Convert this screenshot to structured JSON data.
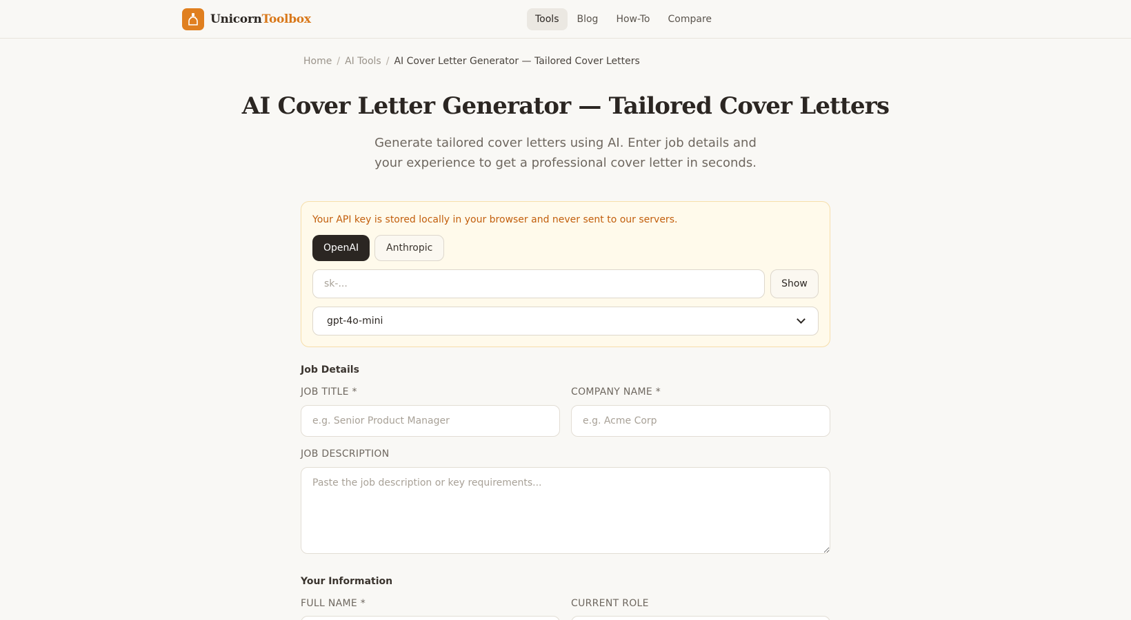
{
  "brand": {
    "name_part1": "Unicorn",
    "name_part2": "Toolbox",
    "accent_color": "#e07f1f"
  },
  "nav": {
    "items": [
      {
        "label": "Tools",
        "active": true
      },
      {
        "label": "Blog",
        "active": false
      },
      {
        "label": "How-To",
        "active": false
      },
      {
        "label": "Compare",
        "active": false
      }
    ]
  },
  "breadcrumb": {
    "home": "Home",
    "section": "AI Tools",
    "current": "AI Cover Letter Generator — Tailored Cover Letters",
    "separator": "/"
  },
  "page": {
    "title": "AI Cover Letter Generator — Tailored Cover Letters",
    "subtitle": "Generate tailored cover letters using AI. Enter job details and your experience to get a professional cover letter in seconds."
  },
  "api": {
    "note": "Your API key is stored locally in your browser and never sent to our servers.",
    "providers": [
      "OpenAI",
      "Anthropic"
    ],
    "selected_provider": "OpenAI",
    "key_placeholder": "sk-...",
    "key_value": "",
    "show_label": "Show",
    "model": "gpt-4o-mini"
  },
  "job_details": {
    "heading": "Job Details",
    "job_title_label": "JOB TITLE *",
    "job_title_placeholder": "e.g. Senior Product Manager",
    "company_label": "COMPANY NAME *",
    "company_placeholder": "e.g. Acme Corp",
    "description_label": "JOB DESCRIPTION",
    "description_placeholder": "Paste the job description or key requirements..."
  },
  "your_information": {
    "heading": "Your Information",
    "full_name_label": "FULL NAME *",
    "current_role_label": "CURRENT ROLE"
  }
}
